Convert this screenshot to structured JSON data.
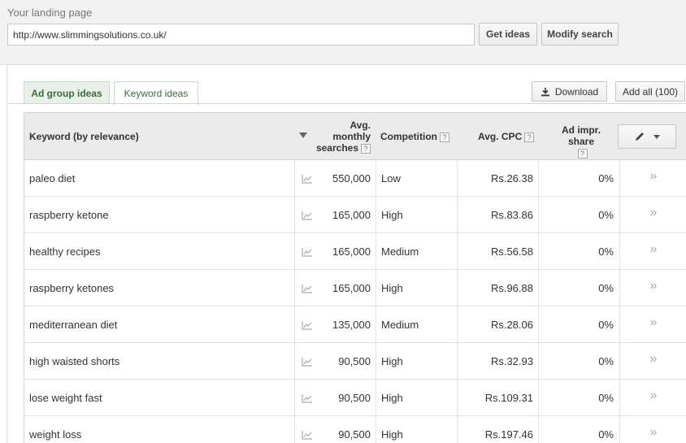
{
  "top": {
    "landing_label": "Your landing page",
    "url_value": "http://www.slimmingsolutions.co.uk/",
    "get_ideas": "Get ideas",
    "modify_search": "Modify search"
  },
  "tabs": {
    "ad_group": "Ad group ideas",
    "keyword": "Keyword ideas"
  },
  "actions": {
    "download": "Download",
    "add_all": "Add all (100)"
  },
  "columns": {
    "keyword": "Keyword (by relevance)",
    "avg_line1": "Avg.",
    "avg_line2": "monthly",
    "avg_line3": "searches",
    "competition": "Competition",
    "cpc": "Avg. CPC",
    "impr": "Ad impr. share",
    "help": "?"
  },
  "rows": [
    {
      "keyword": "paleo diet",
      "searches": "550,000",
      "competition": "Low",
      "cpc": "Rs.26.38",
      "share": "0%",
      "add": "»"
    },
    {
      "keyword": "raspberry ketone",
      "searches": "165,000",
      "competition": "High",
      "cpc": "Rs.83.86",
      "share": "0%",
      "add": "»"
    },
    {
      "keyword": "healthy recipes",
      "searches": "165,000",
      "competition": "Medium",
      "cpc": "Rs.56.58",
      "share": "0%",
      "add": "»"
    },
    {
      "keyword": "raspberry ketones",
      "searches": "165,000",
      "competition": "High",
      "cpc": "Rs.96.88",
      "share": "0%",
      "add": "»"
    },
    {
      "keyword": "mediterranean diet",
      "searches": "135,000",
      "competition": "Medium",
      "cpc": "Rs.28.06",
      "share": "0%",
      "add": "»"
    },
    {
      "keyword": "high waisted shorts",
      "searches": "90,500",
      "competition": "High",
      "cpc": "Rs.32.93",
      "share": "0%",
      "add": "»"
    },
    {
      "keyword": "lose weight fast",
      "searches": "90,500",
      "competition": "High",
      "cpc": "Rs.109.31",
      "share": "0%",
      "add": "»"
    },
    {
      "keyword": "weight loss",
      "searches": "90,500",
      "competition": "High",
      "cpc": "Rs.197.46",
      "share": "0%",
      "add": "»"
    }
  ],
  "icons": {
    "trend": "trend-chart-icon",
    "download": "download-icon",
    "pencil": "pencil-icon"
  }
}
